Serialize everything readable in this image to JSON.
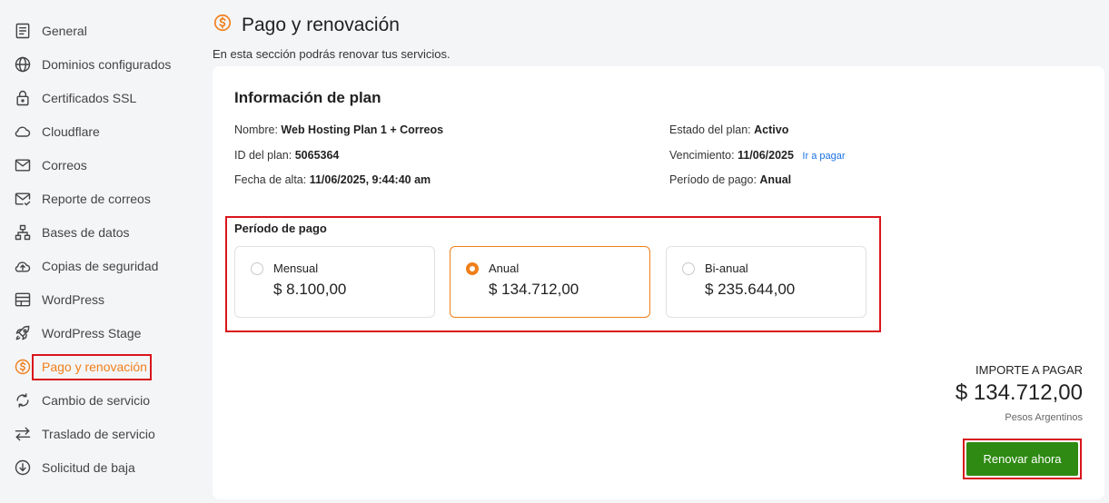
{
  "sidebar": {
    "items": [
      {
        "label": "General",
        "icon": "document-icon"
      },
      {
        "label": "Dominios configurados",
        "icon": "globe-icon"
      },
      {
        "label": "Certificados SSL",
        "icon": "lock-icon"
      },
      {
        "label": "Cloudflare",
        "icon": "cloud-icon"
      },
      {
        "label": "Correos",
        "icon": "mail-icon"
      },
      {
        "label": "Reporte de correos",
        "icon": "mail-check-icon"
      },
      {
        "label": "Bases de datos",
        "icon": "database-icon"
      },
      {
        "label": "Copias de seguridad",
        "icon": "cloud-upload-icon"
      },
      {
        "label": "WordPress",
        "icon": "browser-icon"
      },
      {
        "label": "WordPress Stage",
        "icon": "rocket-icon"
      },
      {
        "label": "Pago y renovación",
        "icon": "dollar-icon",
        "active": true
      },
      {
        "label": "Cambio de servicio",
        "icon": "refresh-icon"
      },
      {
        "label": "Traslado de servicio",
        "icon": "transfer-icon"
      },
      {
        "label": "Solicitud de baja",
        "icon": "arrow-down-circle-icon"
      }
    ]
  },
  "header": {
    "title": "Pago y renovación",
    "subtitle": "En esta sección podrás renovar tus servicios."
  },
  "plan": {
    "section_title": "Información de plan",
    "name_label": "Nombre:",
    "name_value": "Web Hosting Plan 1 + Correos",
    "id_label": "ID del plan:",
    "id_value": "5065364",
    "created_label": "Fecha de alta:",
    "created_value": "11/06/2025, 9:44:40 am",
    "status_label": "Estado del plan:",
    "status_value": "Activo",
    "expiry_label": "Vencimiento:",
    "expiry_value": "11/06/2025",
    "pay_link": "Ir a pagar",
    "period_label": "Período de pago:",
    "period_value": "Anual"
  },
  "period": {
    "title": "Período de pago",
    "options": [
      {
        "name": "Mensual",
        "price": "$ 8.100,00",
        "selected": false
      },
      {
        "name": "Anual",
        "price": "$ 134.712,00",
        "selected": true
      },
      {
        "name": "Bi-anual",
        "price": "$ 235.644,00",
        "selected": false
      }
    ]
  },
  "total": {
    "label": "IMPORTE A PAGAR",
    "amount": "$ 134.712,00",
    "currency": "Pesos Argentinos"
  },
  "renew_button": "Renovar ahora",
  "colors": {
    "accent": "#f07f1a",
    "highlight": "#d9161c",
    "button": "#2e8a12",
    "link": "#1a73e8"
  }
}
